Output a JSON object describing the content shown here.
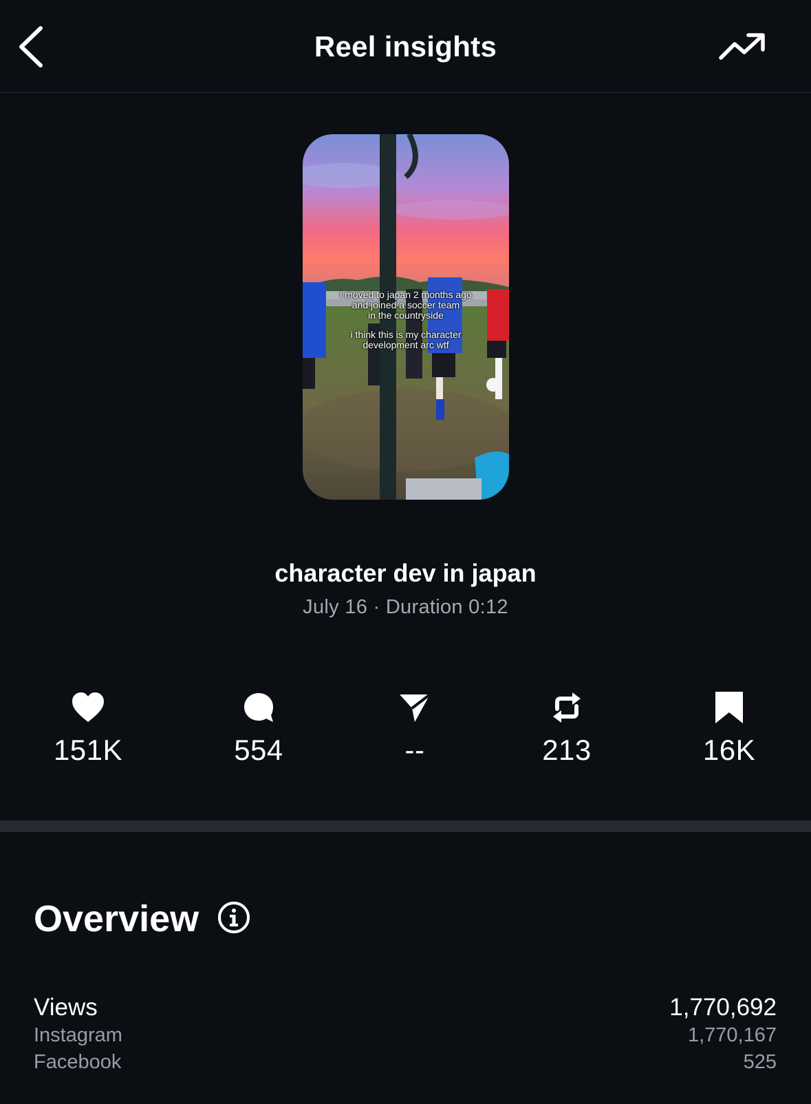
{
  "header": {
    "title": "Reel insights",
    "back_icon": "chevron-left-icon",
    "trend_icon": "trending-up-icon"
  },
  "thumbnail": {
    "caption_line1": "i moved to japan 2 months ago\nand joined a soccer team\nin the countryside",
    "caption_line2": "i think this is my character\ndevelopment arc wtf"
  },
  "reel": {
    "title": "character dev in japan",
    "meta": "July 16 · Duration 0:12"
  },
  "stats": [
    {
      "icon": "heart-icon",
      "value": "151K"
    },
    {
      "icon": "comment-icon",
      "value": "554"
    },
    {
      "icon": "share-icon",
      "value": "--"
    },
    {
      "icon": "repost-icon",
      "value": "213"
    },
    {
      "icon": "bookmark-icon",
      "value": "16K"
    }
  ],
  "overview": {
    "title": "Overview",
    "views_label": "Views",
    "views_value": "1,770,692",
    "instagram_label": "Instagram",
    "instagram_value": "1,770,167",
    "facebook_label": "Facebook",
    "facebook_value": "525"
  },
  "colors": {
    "background": "#0b0e13",
    "divider": "#262a31",
    "secondary_text": "#a6a9b0"
  }
}
